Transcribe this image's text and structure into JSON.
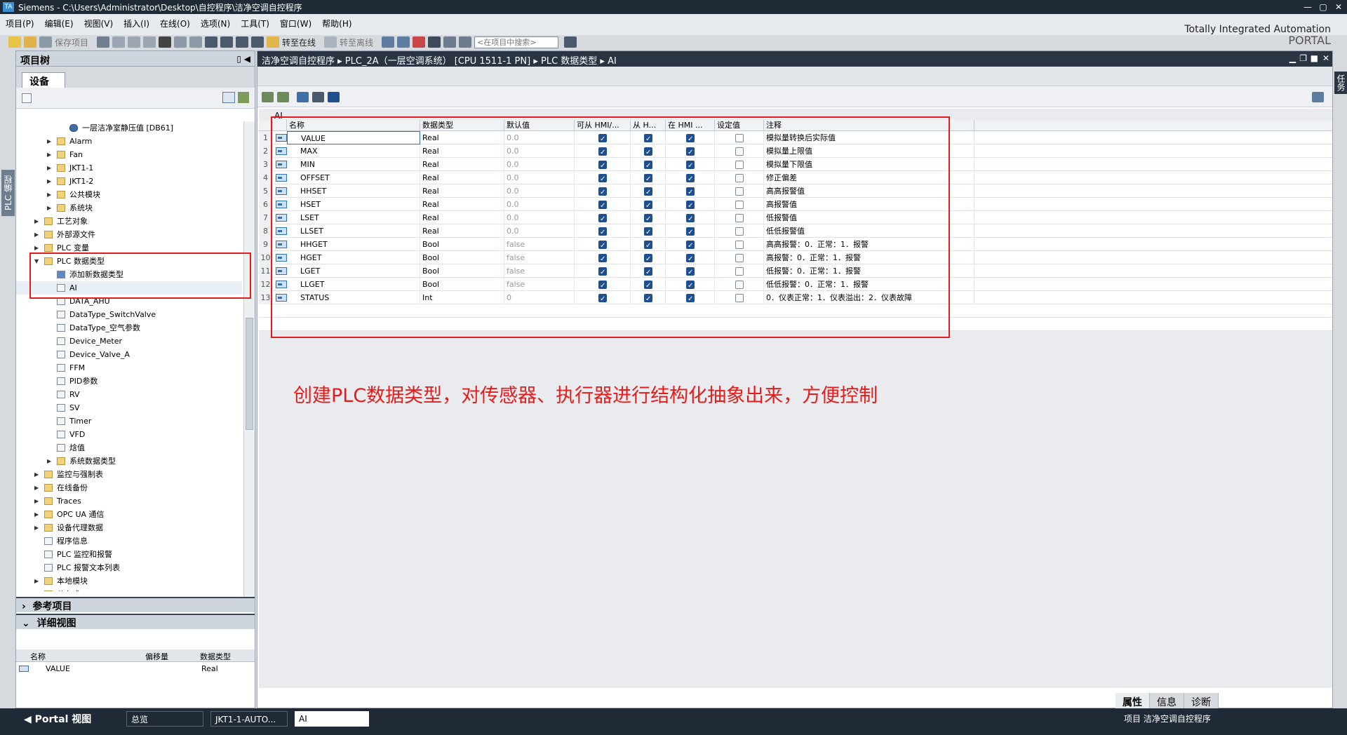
{
  "window": {
    "title": "Siemens  -  C:\\Users\\Administrator\\Desktop\\自控程序\\洁净空调自控程序"
  },
  "menu": [
    "项目(P)",
    "编辑(E)",
    "视图(V)",
    "插入(I)",
    "在线(O)",
    "选项(N)",
    "工具(T)",
    "窗口(W)",
    "帮助(H)"
  ],
  "brand": {
    "line1": "Totally Integrated Automation",
    "line2": "PORTAL"
  },
  "toolbar": {
    "save": "保存项目",
    "go_online": "转至在线",
    "go_offline": "转至离线",
    "search_placeholder": "<在项目中搜索>"
  },
  "left_strip": {
    "label": "PLC 编程"
  },
  "project_tree": {
    "title": "项目树",
    "tab": "设备",
    "items": [
      {
        "label": "一层洁净室静压值 [DB61]",
        "indent": 3,
        "twisty": "",
        "icon": "db-icon"
      },
      {
        "label": "Alarm",
        "indent": 2,
        "twisty": "▶",
        "icon": "folder-icon"
      },
      {
        "label": "Fan",
        "indent": 2,
        "twisty": "▶",
        "icon": "folder-icon"
      },
      {
        "label": "JKT1-1",
        "indent": 2,
        "twisty": "▶",
        "icon": "folder-icon"
      },
      {
        "label": "JKT1-2",
        "indent": 2,
        "twisty": "▶",
        "icon": "folder-icon"
      },
      {
        "label": "公共模块",
        "indent": 2,
        "twisty": "▶",
        "icon": "folder-icon"
      },
      {
        "label": "系统块",
        "indent": 2,
        "twisty": "▶",
        "icon": "folder-icon"
      },
      {
        "label": "工艺对象",
        "indent": 1,
        "twisty": "▶",
        "icon": "folder-icon"
      },
      {
        "label": "外部源文件",
        "indent": 1,
        "twisty": "▶",
        "icon": "folder-icon"
      },
      {
        "label": "PLC 变量",
        "indent": 1,
        "twisty": "▶",
        "icon": "folder-icon"
      },
      {
        "label": "PLC 数据类型",
        "indent": 1,
        "twisty": "▼",
        "icon": "folder-icon"
      },
      {
        "label": "添加新数据类型",
        "indent": 2,
        "twisty": "",
        "icon": "add-icon"
      },
      {
        "label": "AI",
        "indent": 2,
        "twisty": "",
        "icon": "udt-icon",
        "selected": true
      },
      {
        "label": "DATA_AHU",
        "indent": 2,
        "twisty": "",
        "icon": "udt-icon"
      },
      {
        "label": "DataType_SwitchValve",
        "indent": 2,
        "twisty": "",
        "icon": "udt-icon"
      },
      {
        "label": "DataType_空气参数",
        "indent": 2,
        "twisty": "",
        "icon": "udt-icon"
      },
      {
        "label": "Device_Meter",
        "indent": 2,
        "twisty": "",
        "icon": "udt-icon"
      },
      {
        "label": "Device_Valve_A",
        "indent": 2,
        "twisty": "",
        "icon": "udt-icon"
      },
      {
        "label": "FFM",
        "indent": 2,
        "twisty": "",
        "icon": "udt-icon"
      },
      {
        "label": "PID参数",
        "indent": 2,
        "twisty": "",
        "icon": "udt-icon"
      },
      {
        "label": "RV",
        "indent": 2,
        "twisty": "",
        "icon": "udt-icon"
      },
      {
        "label": "SV",
        "indent": 2,
        "twisty": "",
        "icon": "udt-icon"
      },
      {
        "label": "Timer",
        "indent": 2,
        "twisty": "",
        "icon": "udt-icon"
      },
      {
        "label": "VFD",
        "indent": 2,
        "twisty": "",
        "icon": "udt-icon"
      },
      {
        "label": "焓值",
        "indent": 2,
        "twisty": "",
        "icon": "udt-icon"
      },
      {
        "label": "系统数据类型",
        "indent": 2,
        "twisty": "▶",
        "icon": "folder-icon"
      },
      {
        "label": "监控与强制表",
        "indent": 1,
        "twisty": "▶",
        "icon": "folder-icon"
      },
      {
        "label": "在线备份",
        "indent": 1,
        "twisty": "▶",
        "icon": "folder-icon"
      },
      {
        "label": "Traces",
        "indent": 1,
        "twisty": "▶",
        "icon": "folder-icon"
      },
      {
        "label": "OPC UA 通信",
        "indent": 1,
        "twisty": "▶",
        "icon": "folder-icon"
      },
      {
        "label": "设备代理数据",
        "indent": 1,
        "twisty": "▶",
        "icon": "folder-icon"
      },
      {
        "label": "程序信息",
        "indent": 1,
        "twisty": "",
        "icon": "info-icon"
      },
      {
        "label": "PLC 监控和报警",
        "indent": 1,
        "twisty": "",
        "icon": "alarm-icon"
      },
      {
        "label": "PLC 报警文本列表",
        "indent": 1,
        "twisty": "",
        "icon": "list-icon"
      },
      {
        "label": "本地模块",
        "indent": 1,
        "twisty": "▶",
        "icon": "folder-icon"
      },
      {
        "label": "分布式 I/O",
        "indent": 1,
        "twisty": "▶",
        "icon": "folder-icon"
      }
    ],
    "reference_projects": "参考项目",
    "detail_view": "详细视图",
    "detail_headers": [
      "名称",
      "偏移量",
      "数据类型"
    ],
    "detail_row": {
      "name": "VALUE",
      "type": "Real"
    }
  },
  "editor": {
    "breadcrumb": "洁净空调自控程序  ▸  PLC_2A（一层空调系统） [CPU 1511-1 PN]  ▸  PLC 数据类型  ▸  AI",
    "type_title": "AI",
    "columns": [
      "名称",
      "数据类型",
      "默认值",
      "可从 HMI/...",
      "从 H...",
      "在 HMI ...",
      "设定值",
      "注释"
    ],
    "rows": [
      {
        "no": "1",
        "name": "VALUE",
        "type": "Real",
        "default": "0.0",
        "hmi1": true,
        "hmi2": true,
        "hmi3": true,
        "setpoint": false,
        "comment": "模拟量转换后实际值"
      },
      {
        "no": "2",
        "name": "MAX",
        "type": "Real",
        "default": "0.0",
        "hmi1": true,
        "hmi2": true,
        "hmi3": true,
        "setpoint": false,
        "comment": "模拟量上限值"
      },
      {
        "no": "3",
        "name": "MIN",
        "type": "Real",
        "default": "0.0",
        "hmi1": true,
        "hmi2": true,
        "hmi3": true,
        "setpoint": false,
        "comment": "模拟量下限值"
      },
      {
        "no": "4",
        "name": "OFFSET",
        "type": "Real",
        "default": "0.0",
        "hmi1": true,
        "hmi2": true,
        "hmi3": true,
        "setpoint": false,
        "comment": "修正偏差"
      },
      {
        "no": "5",
        "name": "HHSET",
        "type": "Real",
        "default": "0.0",
        "hmi1": true,
        "hmi2": true,
        "hmi3": true,
        "setpoint": false,
        "comment": "高高报警值"
      },
      {
        "no": "6",
        "name": "HSET",
        "type": "Real",
        "default": "0.0",
        "hmi1": true,
        "hmi2": true,
        "hmi3": true,
        "setpoint": false,
        "comment": "高报警值"
      },
      {
        "no": "7",
        "name": "LSET",
        "type": "Real",
        "default": "0.0",
        "hmi1": true,
        "hmi2": true,
        "hmi3": true,
        "setpoint": false,
        "comment": "低报警值"
      },
      {
        "no": "8",
        "name": "LLSET",
        "type": "Real",
        "default": "0.0",
        "hmi1": true,
        "hmi2": true,
        "hmi3": true,
        "setpoint": false,
        "comment": "低低报警值"
      },
      {
        "no": "9",
        "name": "HHGET",
        "type": "Bool",
        "default": "false",
        "hmi1": true,
        "hmi2": true,
        "hmi3": true,
        "setpoint": false,
        "comment": "高高报警：0．正常：1．报警"
      },
      {
        "no": "10",
        "name": "HGET",
        "type": "Bool",
        "default": "false",
        "hmi1": true,
        "hmi2": true,
        "hmi3": true,
        "setpoint": false,
        "comment": "高报警：0．正常：1．报警"
      },
      {
        "no": "11",
        "name": "LGET",
        "type": "Bool",
        "default": "false",
        "hmi1": true,
        "hmi2": true,
        "hmi3": true,
        "setpoint": false,
        "comment": "低报警：0．正常：1．报警"
      },
      {
        "no": "12",
        "name": "LLGET",
        "type": "Bool",
        "default": "false",
        "hmi1": true,
        "hmi2": true,
        "hmi3": true,
        "setpoint": false,
        "comment": "低低报警：0．正常：1．报警"
      },
      {
        "no": "13",
        "name": "STATUS",
        "type": "Int",
        "default": "0",
        "hmi1": true,
        "hmi2": true,
        "hmi3": true,
        "setpoint": false,
        "comment": "0．仪表正常：1．仪表溢出：2．仪表故障"
      }
    ],
    "annotation": "创建PLC数据类型，对传感器、执行器进行结构化抽象出来，方便控制"
  },
  "right_strip": {
    "label": "任务"
  },
  "bottom_tabs": [
    "属性",
    "信息",
    "诊断"
  ],
  "taskbar": {
    "portal": "Portal 视图",
    "tasks": [
      "总览",
      "JKT1-1-AUTO...",
      "AI"
    ],
    "status": "项目 洁净空调自控程序"
  },
  "colors": {
    "accent": "#1e4f8f",
    "annotation_red": "#e51c1c",
    "title_bg": "#1f2a36"
  }
}
